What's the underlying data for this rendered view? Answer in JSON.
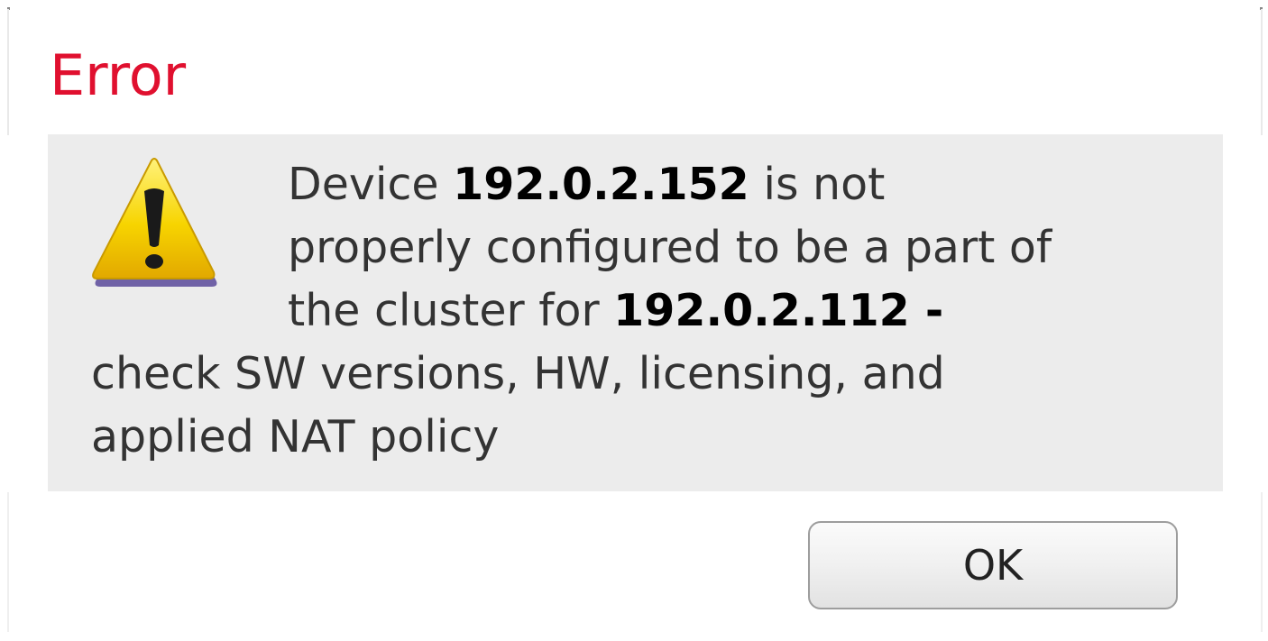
{
  "dialog": {
    "title": "Error",
    "icon": "warning-icon",
    "message": {
      "prefix": "Device ",
      "device_ip": "192.0.2.152",
      "line1_suffix": " is not",
      "line2": "properly configured to be a part of",
      "line3_prefix": "the cluster for ",
      "cluster_ip": "192.0.2.112 -",
      "line4": "check SW versions, HW, licensing, and",
      "line5": "applied NAT policy"
    },
    "ok_label": "OK"
  },
  "colors": {
    "title": "#e0102f",
    "panel": "#ececec",
    "warning_fill": "#f5d000"
  }
}
